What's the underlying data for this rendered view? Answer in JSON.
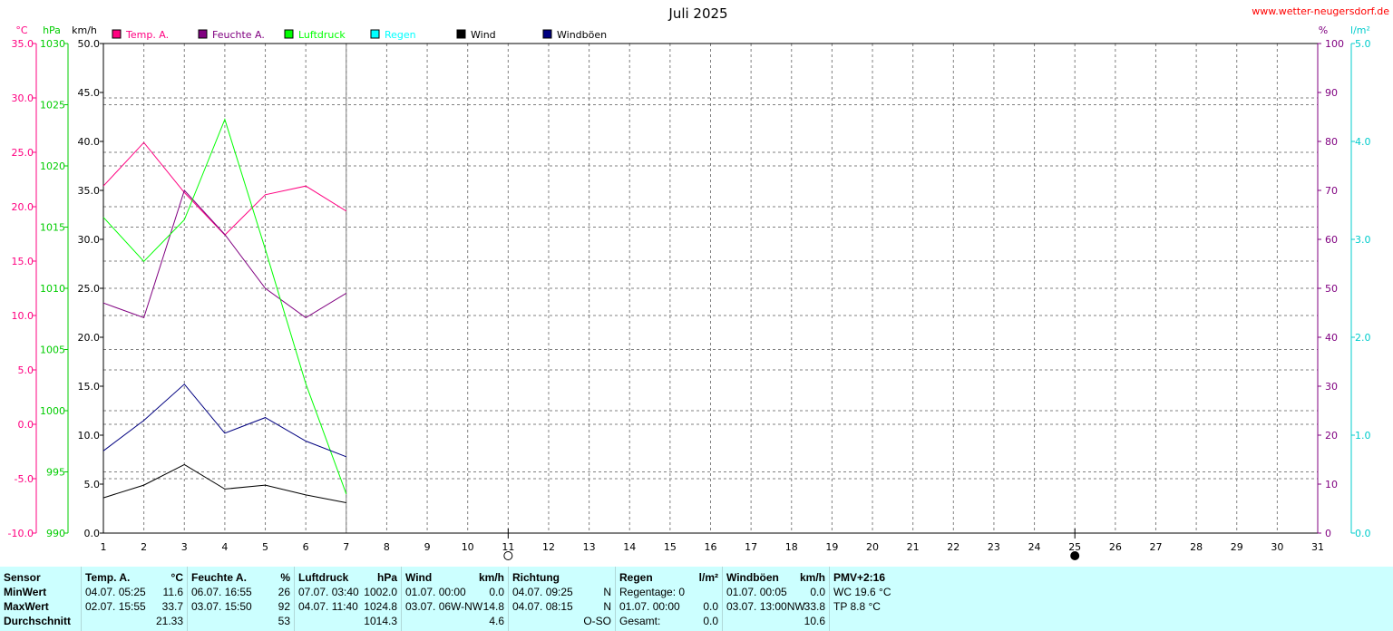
{
  "chart_data": {
    "type": "line",
    "title": "Juli 2025",
    "watermark": "www.wetter-neugersdorf.de",
    "x": [
      1,
      2,
      3,
      4,
      5,
      6,
      7
    ],
    "x_ticks": [
      1,
      2,
      3,
      4,
      5,
      6,
      7,
      8,
      9,
      10,
      11,
      12,
      13,
      14,
      15,
      16,
      17,
      18,
      19,
      20,
      21,
      22,
      23,
      24,
      25,
      26,
      27,
      28,
      29,
      30,
      31
    ],
    "xlim": [
      1,
      31
    ],
    "grid": true,
    "legend_position": "top",
    "axes": {
      "temp": {
        "unit": "°C",
        "lim": [
          -10,
          35
        ],
        "ticks": [
          "35.0",
          "30.0",
          "25.0",
          "20.0",
          "15.0",
          "10.0",
          "5.0",
          "0.0",
          "-5.0",
          "-10.0"
        ],
        "color": "#ff0080"
      },
      "press": {
        "unit": "hPa",
        "lim": [
          990,
          1030
        ],
        "ticks": [
          "1030",
          "1025",
          "1020",
          "1015",
          "1010",
          "1005",
          "1000",
          "995",
          "990"
        ],
        "color": "#00cc00"
      },
      "wind": {
        "unit": "km/h",
        "lim": [
          0,
          50
        ],
        "ticks": [
          "50.0",
          "45.0",
          "40.0",
          "35.0",
          "30.0",
          "25.0",
          "20.0",
          "15.0",
          "10.0",
          "5.0",
          "0.0"
        ],
        "color": "#000000"
      },
      "hum": {
        "unit": "%",
        "lim": [
          0,
          100
        ],
        "ticks": [
          "100",
          "90",
          "80",
          "70",
          "60",
          "50",
          "40",
          "30",
          "20",
          "10",
          "0"
        ],
        "color": "#800080"
      },
      "rain": {
        "unit": "l/m²",
        "lim": [
          0,
          5
        ],
        "ticks": [
          "5.0",
          "4.0",
          "3.0",
          "2.0",
          "1.0",
          "0.0"
        ],
        "color": "#00cccc"
      }
    },
    "series": [
      {
        "name": "Temp. A.",
        "axis": "temp",
        "color": "#ff0080",
        "values": [
          21.9,
          25.9,
          21.3,
          17.4,
          21.1,
          21.9,
          19.6
        ]
      },
      {
        "name": "Feuchte A.",
        "axis": "hum",
        "color": "#800080",
        "values": [
          47,
          44,
          70,
          61,
          50,
          44,
          49
        ]
      },
      {
        "name": "Luftdruck",
        "axis": "press",
        "color": "#00ff00",
        "values": [
          1015.8,
          1012.2,
          1015.6,
          1023.8,
          1013.2,
          1002.2,
          993.2
        ]
      },
      {
        "name": "Regen",
        "axis": "rain",
        "color": "#00ffff",
        "values": []
      },
      {
        "name": "Wind",
        "axis": "wind",
        "color": "#000000",
        "values": [
          3.6,
          4.9,
          7.0,
          4.5,
          4.9,
          3.9,
          3.1
        ]
      },
      {
        "name": "Windböen",
        "axis": "wind",
        "color": "#000080",
        "values": [
          8.4,
          11.5,
          15.2,
          10.2,
          11.8,
          9.4,
          7.8
        ]
      }
    ],
    "moon_phases": [
      {
        "day": 11,
        "phase": "full"
      },
      {
        "day": 25,
        "phase": "new"
      }
    ]
  },
  "stats": {
    "rows": [
      "Sensor",
      "MinWert",
      "MaxWert",
      "Durchschnitt"
    ],
    "temp": {
      "h1": "Temp. A.",
      "h2": "°C",
      "min_date": "04.07.  05:25",
      "min_val": "11.6",
      "max_date": "02.07.  15:55",
      "max_val": "33.7",
      "avg": "21.33"
    },
    "hum": {
      "h1": "Feuchte A.",
      "h2": "%",
      "min_date": "06.07.  16:55",
      "min_val": "26",
      "max_date": "03.07.  15:50",
      "max_val": "92",
      "avg": "53"
    },
    "press": {
      "h1": "Luftdruck",
      "h2": "hPa",
      "min_date": "07.07.  03:40",
      "min_val": "1002.0",
      "max_date": "04.07.  11:40",
      "max_val": "1024.8",
      "avg": "1014.3"
    },
    "wind": {
      "h1": "Wind",
      "h2": "km/h",
      "min_date": "01.07.  00:00",
      "min_val": "0.0",
      "max_date": "03.07.  0",
      "max_dir": "6W-NW",
      "max_val": "14.8",
      "avg": "4.6"
    },
    "dir": {
      "h1": "Richtung",
      "min_date": "04.07.  09:25",
      "min_val": "N",
      "max_date": "04.07.  08:15",
      "max_val": "N",
      "avg": "O-SO"
    },
    "rain": {
      "h1": "Regen",
      "h2": "l/m²",
      "l1": "Regentage: 0",
      "l2": "01.07.  00:00",
      "v2": "0.0",
      "l3": "Gesamt:",
      "v3": "0.0"
    },
    "gust": {
      "h1": "Windböen",
      "h2": "km/h",
      "min_date": "01.07.  00:05",
      "min_val": "0.0",
      "max_date": "03.07.  13:00",
      "max_dir": "NW",
      "max_val": "33.8",
      "avg": "10.6"
    },
    "pmv": {
      "h1": "PMV+2:16",
      "l1": "WC 19.6 °C",
      "l2": "TP 8.8 °C"
    }
  }
}
